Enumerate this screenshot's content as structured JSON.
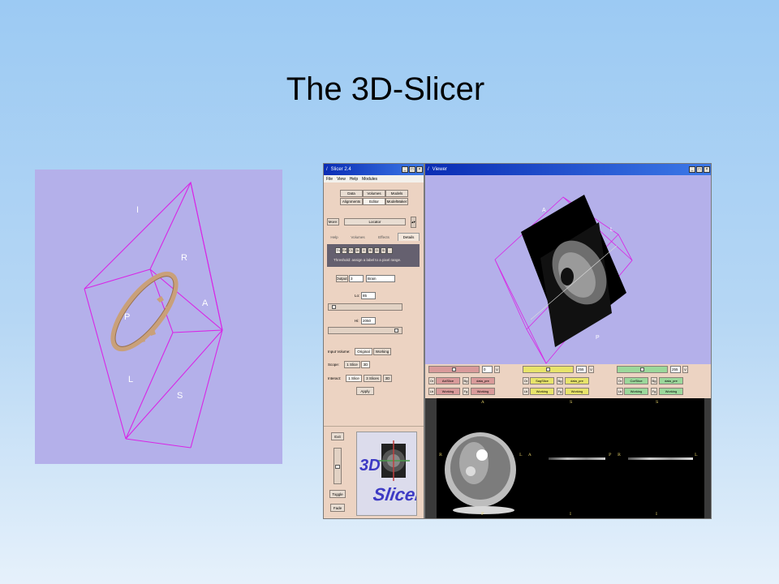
{
  "slide": {
    "title": "The 3D-Slicer"
  },
  "render3d": {
    "labels": {
      "I": "I",
      "R": "R",
      "A": "A",
      "P": "P",
      "L": "L",
      "S": "S"
    }
  },
  "slicer_window": {
    "title": "Slicer 2.4",
    "menu": [
      "File",
      "View",
      "Help",
      "Modules"
    ],
    "module_buttons": [
      "Data",
      "Volumes",
      "Models",
      "Alignments",
      "Editor",
      "ModelMaker"
    ],
    "more_label": "More:",
    "locator_label": "Locator",
    "tabs": [
      "Help",
      "Volumes",
      "Effects",
      "Details"
    ],
    "effect_buttons": [
      "Th",
      "Ed",
      "CL",
      "Dr",
      "II",
      "RI",
      "CI",
      "SI",
      "..."
    ],
    "threshold_hint": "Threshold: assign a label to a pixel range.",
    "output_label": "Output:",
    "output_value": "3",
    "output_name": "Brain",
    "lo_label": "Lo:",
    "lo_value": "85",
    "hi_label": "Hi:",
    "hi_value": "2050",
    "input_volume_label": "Input Volume:",
    "input_volume_options": [
      "Original",
      "Working"
    ],
    "scope_label": "Scope:",
    "scope_options": [
      "1 Slice",
      "3D"
    ],
    "interact_label": "Interact:",
    "interact_options": [
      "1 Slice",
      "3 Slices",
      "3D"
    ],
    "apply_label": "Apply",
    "side_buttons": [
      "Exit",
      "Toggle",
      "Fade"
    ],
    "logo_text_3d": "3D",
    "logo_text_slicer": "Slicer"
  },
  "viewer_window": {
    "title": "Viewer",
    "orientation_labels": {
      "A": "A",
      "L": "L",
      "P": "P"
    },
    "slice_controls": [
      {
        "color": "#d99a9a",
        "slider_value": "0",
        "v_label": "V",
        "or_label": "Or",
        "orient": "AxiSlice",
        "bg_label": "Bg",
        "bg": "data_pre",
        "lb_label": "Lb",
        "lb": "Working",
        "fg_label": "Fg",
        "fg": "Working"
      },
      {
        "color": "#e8e46a",
        "slider_value": "255",
        "v_label": "V",
        "or_label": "Or",
        "orient": "SagSlice",
        "bg_label": "Bg",
        "bg": "data_pre",
        "lb_label": "Lb",
        "lb": "Working",
        "fg_label": "Fg",
        "fg": "Working"
      },
      {
        "color": "#9bd89b",
        "slider_value": "255",
        "v_label": "V",
        "or_label": "Or",
        "orient": "CorSlice",
        "bg_label": "Bg",
        "bg": "data_pre",
        "lb_label": "Lb",
        "lb": "Working",
        "fg_label": "Fg",
        "fg": "Working"
      }
    ],
    "slice_labels": [
      {
        "top": "A",
        "left": "R",
        "right": "L",
        "bottom": "P"
      },
      {
        "top": "S",
        "left": "A",
        "right": "P",
        "bottom": "I"
      },
      {
        "top": "S",
        "left": "R",
        "right": "L",
        "bottom": "I"
      }
    ]
  },
  "colors": {
    "slide_bg_top": "#9ccaf3",
    "render_bg": "#b4b0ea",
    "wireframe": "#d826e6",
    "model": "#c9a07a",
    "panel": "#ecd3c2",
    "titlebar": "#0a2cb4"
  }
}
